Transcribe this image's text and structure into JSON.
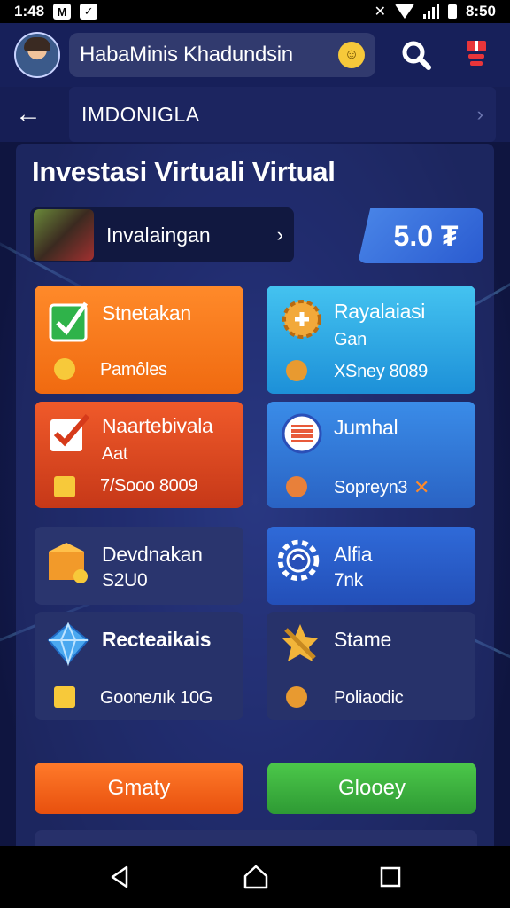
{
  "status_bar": {
    "time": "1:48",
    "icon_a": "M",
    "clock": "8:50"
  },
  "header": {
    "username": "HabaMinis  Khadundsin"
  },
  "nav": {
    "title": "IMDONIGLA"
  },
  "page_title": "Investasi Virtuali Virtual",
  "invest_row": {
    "label": "Invalaingan"
  },
  "amount": "5.0 ₮",
  "cards": [
    {
      "title": "Stnetakan",
      "sub": "Pamôles"
    },
    {
      "title": "Rayalaiasi",
      "title2": "Gan",
      "sub": "XSney 8089"
    },
    {
      "title": "Naartebivala",
      "title2": "Aat",
      "sub": "7/Sooo 8009"
    },
    {
      "title": "Jumhal",
      "sub": "Sopreyn3"
    },
    {
      "title": "Devdnakan",
      "title2": "S2U0"
    },
    {
      "title": "Alfia",
      "title2": "7nk"
    },
    {
      "title": "Recteaikais",
      "sub": "Gooneлık 10G"
    },
    {
      "title": "Stame",
      "sub": "Poliaodic"
    }
  ],
  "buttons": {
    "left": "Gmaty",
    "right": "Glooey"
  },
  "colors": {
    "accent_orange": "#f06a10",
    "accent_green": "#2e9a34",
    "accent_blue": "#2a63c4",
    "bg": "#0f1540"
  }
}
